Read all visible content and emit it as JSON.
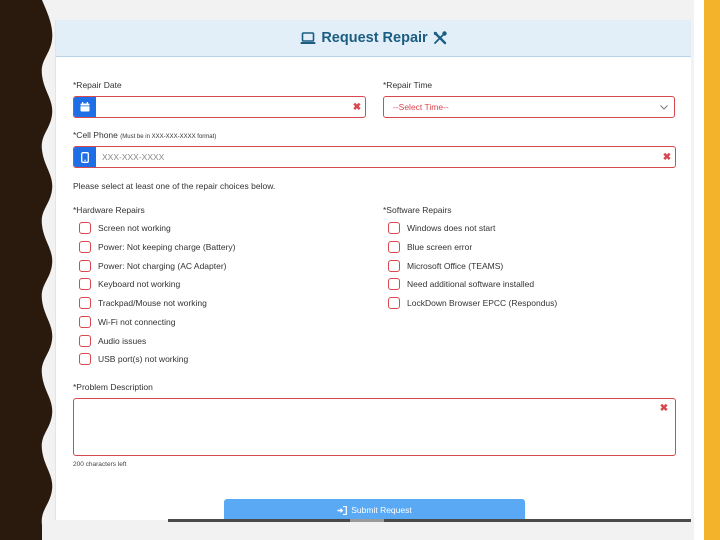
{
  "header": {
    "title": "Request Repair"
  },
  "repair_date": {
    "label": "*Repair Date",
    "value": ""
  },
  "repair_time": {
    "label": "*Repair Time",
    "selected": "--Select Time--"
  },
  "cell_phone": {
    "label": "*Cell Phone",
    "hint": "(Must be in XXX-XXX-XXXX format)",
    "placeholder": "XXX-XXX-XXXX"
  },
  "instructions": "Please select at least one of the repair choices below.",
  "hardware": {
    "label": "*Hardware Repairs",
    "items": [
      "Screen not working",
      "Power: Not keeping charge (Battery)",
      "Power: Not charging (AC Adapter)",
      "Keyboard not working",
      "Trackpad/Mouse not working",
      "Wi-Fi not connecting",
      "Audio issues",
      "USB port(s) not working"
    ]
  },
  "software": {
    "label": "*Software Repairs",
    "items": [
      "Windows does not start",
      "Blue screen error",
      "Microsoft Office (TEAMS)",
      "Need additional software installed",
      "LockDown Browser EPCC (Respondus)"
    ]
  },
  "problem": {
    "label": "*Problem Description",
    "chars_left": "200 characters left"
  },
  "submit": {
    "label": "Submit Request"
  },
  "colors": {
    "accent": "#1e6fe6",
    "error": "#d9474f",
    "header_text": "#1b5e82",
    "submit_bg": "#5aa9f5",
    "gold": "#f3b32a"
  }
}
